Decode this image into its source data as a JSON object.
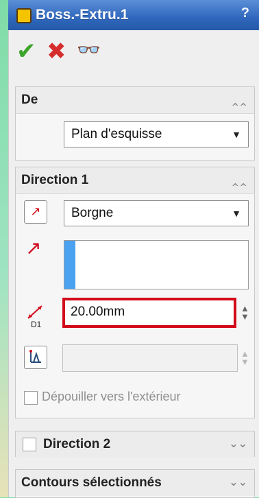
{
  "titlebar": {
    "title": "Boss.-Extru.1",
    "help": "?"
  },
  "toolbar": {
    "ok_icon": "check-icon",
    "cancel_icon": "x-icon",
    "preview_icon": "glasses-icon"
  },
  "de": {
    "header": "De",
    "start_condition": "Plan d'esquisse"
  },
  "direction1": {
    "header": "Direction 1",
    "end_condition": "Borgne",
    "depth_value": "20.00mm",
    "depth_badge": "D1",
    "draft_label": "Dépouiller vers l'extérieur"
  },
  "direction2": {
    "header": "Direction 2"
  },
  "contours": {
    "header": "Contours sélectionnés"
  },
  "colors": {
    "highlight": "#d20a1a",
    "selection_stripe": "#4aa2f0",
    "titlebar": "#2f67bd"
  }
}
